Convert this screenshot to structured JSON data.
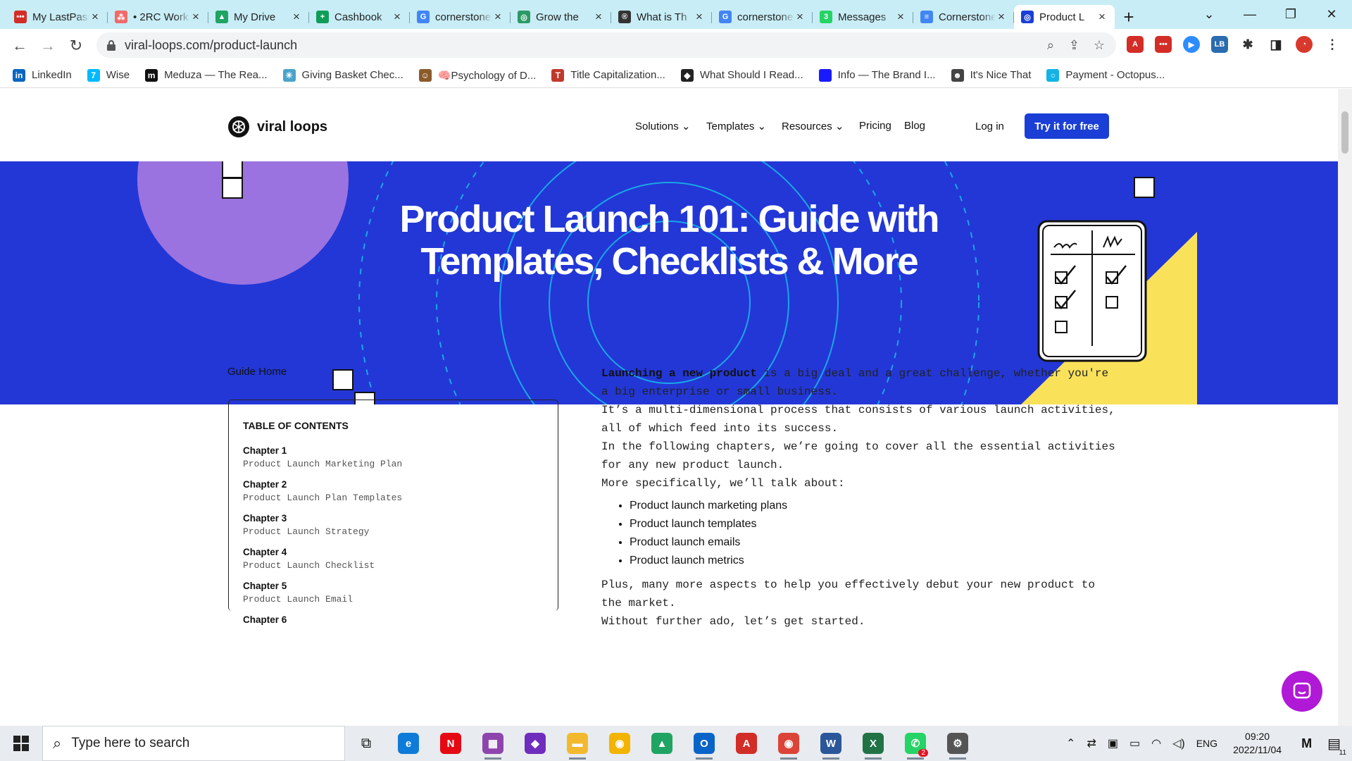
{
  "browser": {
    "tabs": [
      {
        "title": "My LastPass",
        "fav_color": "#d32d27",
        "fav_text": "•••"
      },
      {
        "title": "• 2RC Work",
        "fav_color": "#f06a6a",
        "fav_text": "⁂"
      },
      {
        "title": "My Drive",
        "fav_color": "#1fa463",
        "fav_text": "▲"
      },
      {
        "title": "Cashbook",
        "fav_color": "#0f9d58",
        "fav_text": "+"
      },
      {
        "title": "cornerstone",
        "fav_color": "#4285f4",
        "fav_text": "G"
      },
      {
        "title": "Grow the",
        "fav_color": "#2b9a66",
        "fav_text": "◎"
      },
      {
        "title": "What is Th",
        "fav_color": "#333333",
        "fav_text": "®"
      },
      {
        "title": "cornerstone",
        "fav_color": "#4285f4",
        "fav_text": "G"
      },
      {
        "title": "Messages",
        "fav_color": "#25d366",
        "fav_text": "3"
      },
      {
        "title": "Cornerstone",
        "fav_color": "#4285f4",
        "fav_text": "≡"
      },
      {
        "title": "Product L",
        "fav_color": "#1a3ed6",
        "fav_text": "◎"
      }
    ],
    "active_tab": 10,
    "url": "viral-loops.com/product-launch",
    "bookmarks": [
      {
        "label": "LinkedIn",
        "color": "#0a66c2",
        "glyph": "in"
      },
      {
        "label": "Wise",
        "color": "#00b9ff",
        "glyph": "7"
      },
      {
        "label": "Meduza — The Rea...",
        "color": "#111111",
        "glyph": "m"
      },
      {
        "label": "Giving Basket Chec...",
        "color": "#4aa3c9",
        "glyph": "✳"
      },
      {
        "label": "🧠Psychology of D...",
        "color": "#8b5a2b",
        "glyph": "☺"
      },
      {
        "label": "Title Capitalization...",
        "color": "#c0392b",
        "glyph": "T"
      },
      {
        "label": "What Should I Read...",
        "color": "#222222",
        "glyph": "◆"
      },
      {
        "label": "Info — The Brand I...",
        "color": "#1a1aff",
        "glyph": ""
      },
      {
        "label": "It's Nice That",
        "color": "#444444",
        "glyph": "☻"
      },
      {
        "label": "Payment - Octopus...",
        "color": "#14b3e6",
        "glyph": "○"
      }
    ]
  },
  "site": {
    "brand": "viral loops",
    "nav": [
      {
        "label": "Solutions",
        "dropdown": true
      },
      {
        "label": "Templates",
        "dropdown": true
      },
      {
        "label": "Resources",
        "dropdown": true
      },
      {
        "label": "Pricing",
        "dropdown": false
      },
      {
        "label": "Blog",
        "dropdown": false
      }
    ],
    "login": "Log in",
    "cta": "Try it for free",
    "hero_title_line1": "Product Launch 101: Guide with",
    "hero_title_line2": "Templates, Checklists & More",
    "colors": {
      "hero": "#2337d6",
      "cta": "#1a3ed6",
      "yellow": "#f9e15a",
      "purple_circle": "#9a73e0"
    }
  },
  "guide_home": "Guide Home",
  "toc": {
    "heading": "TABLE OF CONTENTS",
    "chapters": [
      {
        "num": "Chapter 1",
        "title": "Product Launch Marketing Plan"
      },
      {
        "num": "Chapter 2",
        "title": "Product Launch Plan Templates"
      },
      {
        "num": "Chapter 3",
        "title": "Product Launch Strategy"
      },
      {
        "num": "Chapter 4",
        "title": "Product Launch Checklist"
      },
      {
        "num": "Chapter 5",
        "title": "Product Launch Email"
      },
      {
        "num": "Chapter 6",
        "title": ""
      }
    ]
  },
  "article": {
    "lead_bold": "Launching a new product",
    "lead_rest": " is a big deal and a great challenge, whether you're a big enterprise or small business.",
    "p2": "It’s a multi-dimensional process that consists of various launch activities, all of which feed into its success.",
    "p3": "In the following chapters, we’re going to cover all the essential activities for any new product launch.",
    "p4": "More specifically, we’ll talk about:",
    "bullets": [
      "Product launch marketing plans",
      "Product launch templates",
      "Product launch emails",
      "Product launch metrics"
    ],
    "p5": "Plus, many more aspects to help you effectively debut your new product to the market.",
    "p6": "Without further ado, let’s get started."
  },
  "taskbar": {
    "search_placeholder": "Type here to search",
    "language": "ENG",
    "time": "09:20",
    "date": "2022/11/04",
    "notifications": "11",
    "whatsapp_badge": "2",
    "apps": [
      {
        "name": "edge",
        "color": "#0f7bd8",
        "glyph": "e"
      },
      {
        "name": "netflix",
        "color": "#e50914",
        "glyph": "N"
      },
      {
        "name": "winrar",
        "color": "#8e44ad",
        "glyph": "▦"
      },
      {
        "name": "app-purple",
        "color": "#6f2dbd",
        "glyph": "◆"
      },
      {
        "name": "file-explorer",
        "color": "#f3b92e",
        "glyph": "▬"
      },
      {
        "name": "chrome-canary",
        "color": "#f2b400",
        "glyph": "◉"
      },
      {
        "name": "google-drive",
        "color": "#1fa463",
        "glyph": "▲"
      },
      {
        "name": "outlook",
        "color": "#0a64c8",
        "glyph": "O"
      },
      {
        "name": "acrobat",
        "color": "#d32d27",
        "glyph": "A"
      },
      {
        "name": "chrome",
        "color": "#db4437",
        "glyph": "◉"
      },
      {
        "name": "word",
        "color": "#2b579a",
        "glyph": "W"
      },
      {
        "name": "excel",
        "color": "#217346",
        "glyph": "X"
      },
      {
        "name": "whatsapp",
        "color": "#25d366",
        "glyph": "✆"
      },
      {
        "name": "settings",
        "color": "#555555",
        "glyph": "⚙"
      }
    ]
  }
}
